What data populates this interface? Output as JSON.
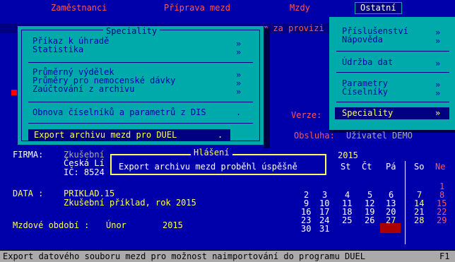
{
  "menubar": {
    "items": [
      {
        "label": "Zaměstnanci"
      },
      {
        "label": "Příprava mezd"
      },
      {
        "label": "Mzdy"
      },
      {
        "label": "Ostatní"
      }
    ]
  },
  "banner": {
    "text": "m za provizi"
  },
  "right_menu": {
    "items": [
      {
        "label": "Příslušenství",
        "chevron": "»"
      },
      {
        "label": "Nápověda",
        "chevron": "»"
      },
      {
        "label": "Údržba dat",
        "chevron": "»"
      },
      {
        "label": "Parametry",
        "chevron": "»"
      },
      {
        "label": "Číselníky",
        "chevron": "»"
      },
      {
        "label": "Speciality",
        "chevron": "»"
      }
    ]
  },
  "version_label": "Verze:",
  "obsluha": {
    "label": "Obsluha:",
    "value": "Uživatel DEMO"
  },
  "speciality_dialog": {
    "title": "Speciality",
    "items": [
      {
        "label": "Příkaz k úhradě",
        "chevron": "»"
      },
      {
        "label": "Statistika",
        "chevron": "»"
      },
      {
        "label": "Průměrný výdělek",
        "chevron": "»"
      },
      {
        "label": "Průměry pro nemocenské dávky",
        "chevron": "»"
      },
      {
        "label": "Zaúčtování z archivu",
        "chevron": "»"
      },
      {
        "label": "Obnova číselníků a parametrů z DIS",
        "chevron": "."
      },
      {
        "label": "Export archivu mezd pro DUEL",
        "chevron": "."
      }
    ]
  },
  "firma": {
    "label": "FIRMA:",
    "name": "Zkušební",
    "address": "Česká Lí",
    "ic": "IČ: 8524"
  },
  "data_info": {
    "label": "DATA :",
    "code": "PRIKLAD.15",
    "description": "Zkušební příklad, rok 2015"
  },
  "period": {
    "label": "Mzdové období :",
    "month": "Únor",
    "year": "2015"
  },
  "hlaseni": {
    "title": "Hlášení",
    "message": "Export archivu mezd proběhl úspěšně"
  },
  "calendar": {
    "year": "2015",
    "headers": [
      "St",
      "Čt",
      "Pá",
      "So",
      "Ne"
    ],
    "weeks": [
      [
        "",
        "",
        "",
        "",
        "1"
      ],
      [
        "2",
        "3",
        "4",
        "5",
        "6",
        "7",
        "8"
      ],
      [
        "9",
        "10",
        "11",
        "12",
        "13",
        "14",
        "15"
      ],
      [
        "16",
        "17",
        "18",
        "19",
        "20",
        "21",
        "22"
      ],
      [
        "23",
        "24",
        "25",
        "26",
        "27",
        "28",
        "29"
      ],
      [
        "30",
        "31"
      ]
    ],
    "selected_day": "27"
  },
  "statusbar": {
    "text": "Export datového souboru mezd pro možnost naimportování do programu DUEL",
    "key": "F1"
  },
  "colors": {
    "background": "#0000aa",
    "panel": "#00aaaa",
    "selection": "#000080",
    "highlight_text": "#ffff55",
    "accent_red": "#ff5555",
    "status": "#aaaaaa"
  }
}
